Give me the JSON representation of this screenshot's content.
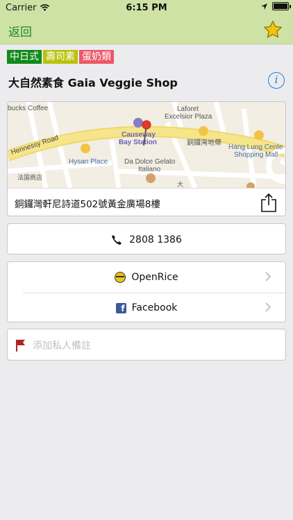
{
  "status_bar": {
    "carrier": "Carrier",
    "time": "6:15 PM",
    "battery_level": 1.0
  },
  "nav": {
    "back_label": "返回",
    "favorite_icon": "star-icon",
    "accent_color": "#1a8a2a",
    "star_color": "#f4c20d"
  },
  "tags": [
    {
      "label": "中日式",
      "color": "#128a1a"
    },
    {
      "label": "壽司素",
      "color": "#b9c30e"
    },
    {
      "label": "蛋奶類",
      "color": "#ec5869"
    }
  ],
  "shop": {
    "name": "大自然素食 Gaia Veggie Shop"
  },
  "map": {
    "labels": {
      "coffee": "bucks Coffee",
      "laforet": "Laforet",
      "excelsior": "Excelsior Plaza",
      "causeway": "Causeway",
      "bay_station": "Bay Station",
      "hennessy": "Hennessy Road",
      "cwb_chinese": "銅鑼灣地帶",
      "hang_lung": "Hang Lung Cente",
      "shopping_mall": "Shopping Mall",
      "hysan": "Hysan Place",
      "dolce": "Da Dolce Gelato",
      "italiano": "Italiano",
      "tiny_left": "法国商店",
      "tiny_bottom": "大"
    }
  },
  "address": "銅鑼灣軒尼詩道502號黃金廣場8樓",
  "phone": "2808 1386",
  "links": [
    {
      "label": "OpenRice",
      "icon": "openrice-icon"
    },
    {
      "label": "Facebook",
      "icon": "facebook-icon"
    }
  ],
  "note": {
    "placeholder": "添加私人備註",
    "icon": "flag-icon",
    "icon_color": "#b0231e"
  }
}
